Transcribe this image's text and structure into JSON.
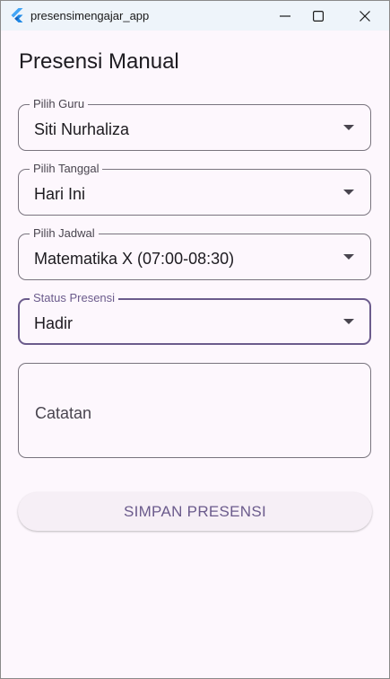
{
  "window": {
    "title": "presensimengajar_app"
  },
  "page": {
    "title": "Presensi Manual"
  },
  "form": {
    "guru": {
      "label": "Pilih Guru",
      "value": "Siti Nurhaliza"
    },
    "tanggal": {
      "label": "Pilih Tanggal",
      "value": "Hari Ini"
    },
    "jadwal": {
      "label": "Pilih Jadwal",
      "value": "Matematika X (07:00-08:30)"
    },
    "status": {
      "label": "Status Presensi",
      "value": "Hadir"
    },
    "catatan": {
      "placeholder": "Catatan",
      "value": ""
    },
    "submit_label": "SIMPAN PRESENSI"
  },
  "colors": {
    "accent": "#6b5b8c",
    "background": "#fdf7fd",
    "outline": "#79747e",
    "titlebar": "#eef4fa"
  },
  "icons": {
    "app": "flutter-logo-icon",
    "minimize": "minimize-icon",
    "maximize": "maximize-icon",
    "close": "close-icon",
    "dropdown": "dropdown-arrow-icon"
  }
}
